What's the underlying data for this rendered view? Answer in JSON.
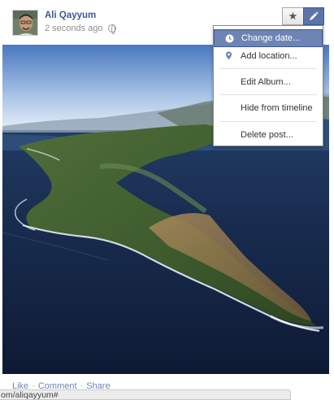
{
  "post": {
    "author": "Ali Qayyum",
    "timestamp": "2 seconds ago",
    "privacy_icon": "globe-icon",
    "avatar": "profile-photo"
  },
  "toolbar": {
    "star_icon": "star-icon",
    "edit_icon": "pencil-icon"
  },
  "menu": {
    "items": [
      {
        "label": "Change date...",
        "icon": "clock-icon",
        "active": true
      },
      {
        "label": "Add location...",
        "icon": "map-pin-icon"
      },
      {
        "label": "Edit Album..."
      },
      {
        "label": "Hide from timeline"
      },
      {
        "label": "Delete post..."
      }
    ]
  },
  "photo": {
    "subject": "aerial-coastline-photo"
  },
  "actions": {
    "like": "Like",
    "comment": "Comment",
    "share": "Share",
    "separator": "·"
  },
  "status_bar": {
    "url": "om/aliqayyum#"
  },
  "colors": {
    "link": "#3b5998",
    "menu_highlight": "#6d84b4",
    "meta_text": "#8e8e8e"
  }
}
